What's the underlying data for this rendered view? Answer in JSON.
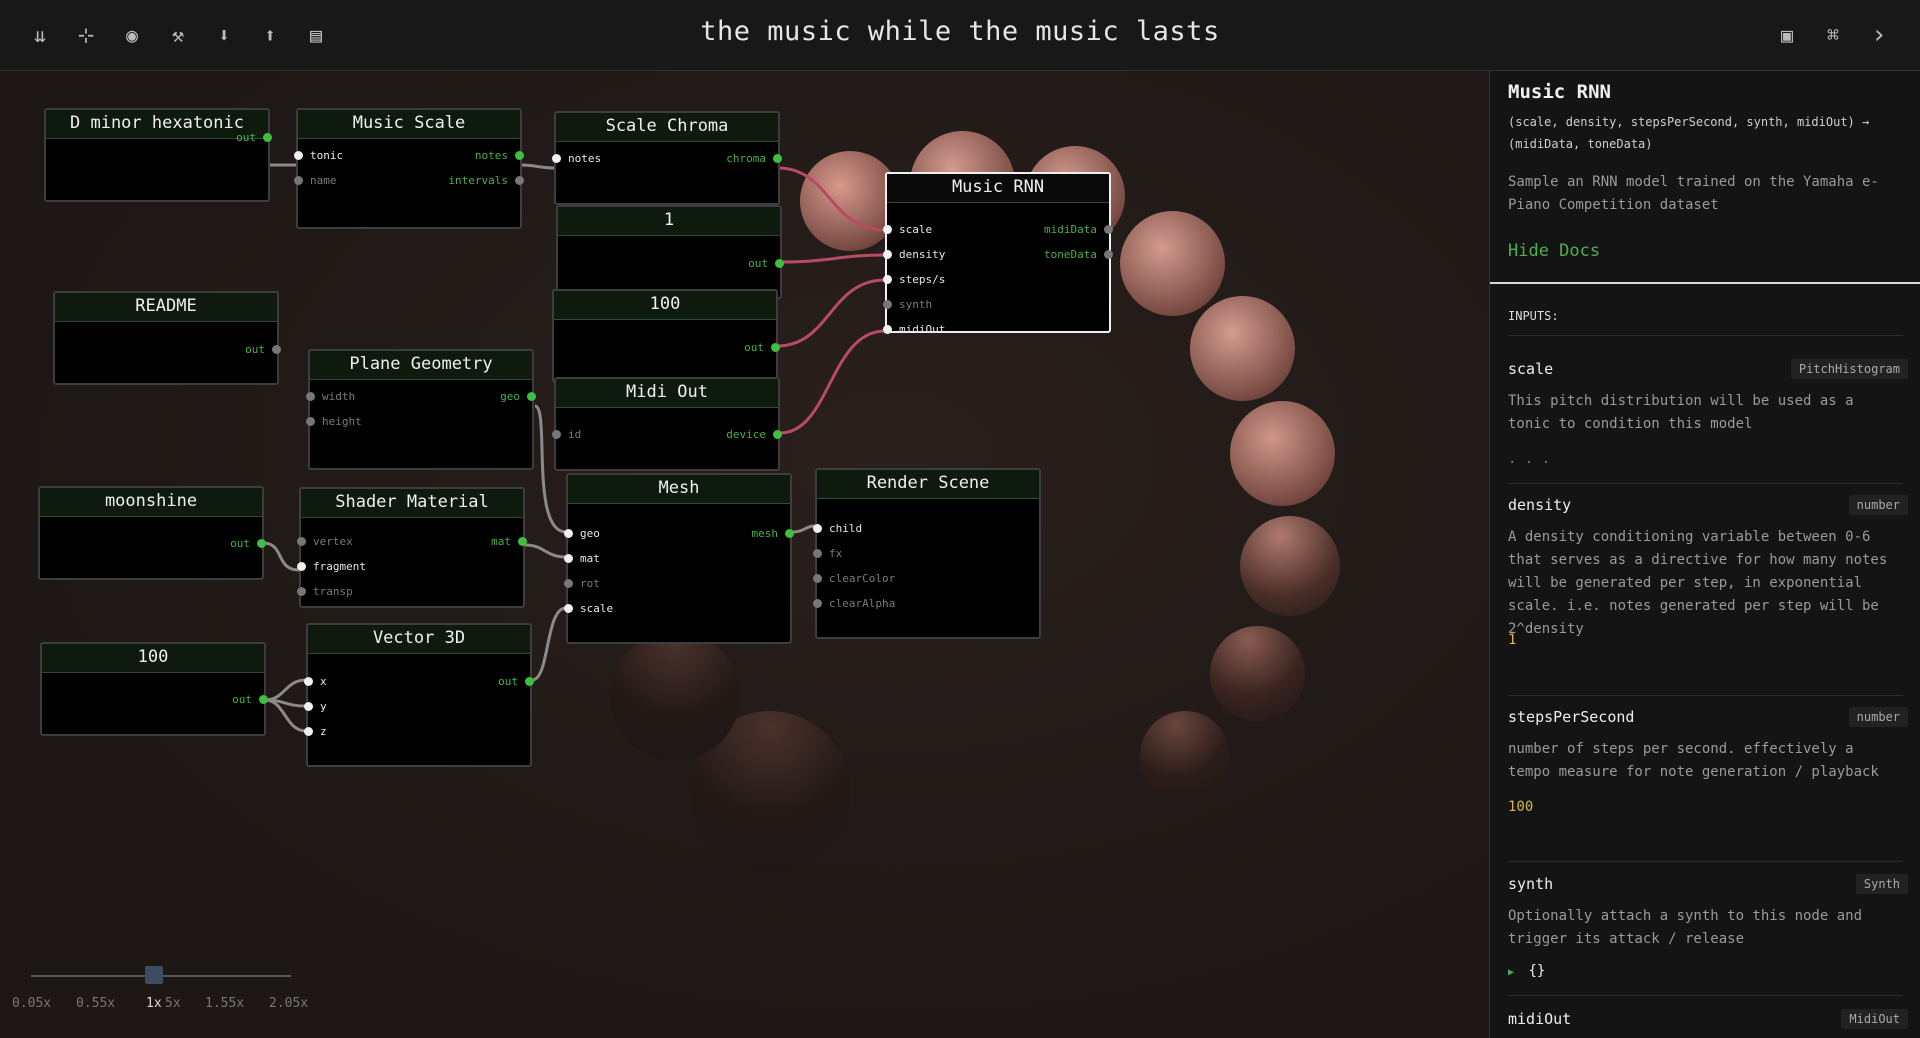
{
  "app": {
    "title": "the music while the music lasts"
  },
  "toolbar_left": [
    {
      "name": "open-graph-icon",
      "glyph": "⇊"
    },
    {
      "name": "add-node-icon",
      "glyph": "⊹"
    },
    {
      "name": "eye-icon",
      "glyph": "◉"
    },
    {
      "name": "build-icon",
      "glyph": "⚒"
    },
    {
      "name": "download-icon",
      "glyph": "⬇"
    },
    {
      "name": "upload-icon",
      "glyph": "⬆"
    },
    {
      "name": "layout-icon",
      "glyph": "▤"
    }
  ],
  "toolbar_right": [
    {
      "name": "panel-icon",
      "glyph": "▣"
    },
    {
      "name": "command-icon",
      "glyph": "⌘"
    },
    {
      "name": "chevron-right-icon",
      "glyph": "›"
    }
  ],
  "nodes": {
    "dminor": {
      "title": "D minor hexatonic",
      "out": "out"
    },
    "musicscale": {
      "title": "Music Scale",
      "in": [
        "tonic",
        "name"
      ],
      "out": [
        "notes",
        "intervals"
      ]
    },
    "scalechroma": {
      "title": "Scale Chroma",
      "in": [
        "notes"
      ],
      "out": [
        "chroma"
      ]
    },
    "one": {
      "title": "1",
      "out": "out"
    },
    "hundred_a": {
      "title": "100",
      "out": "out"
    },
    "readme": {
      "title": "README",
      "out": "out"
    },
    "plane": {
      "title": "Plane Geometry",
      "in": [
        "width",
        "height"
      ],
      "out": [
        "geo"
      ]
    },
    "midiout": {
      "title": "Midi Out",
      "in": [
        "id"
      ],
      "out": [
        "device"
      ]
    },
    "rnn": {
      "title": "Music RNN",
      "in": [
        "scale",
        "density",
        "steps/s",
        "synth",
        "midiOut"
      ],
      "out": [
        "midiData",
        "toneData"
      ]
    },
    "moonshine": {
      "title": "moonshine",
      "out": "out"
    },
    "shader": {
      "title": "Shader Material",
      "in": [
        "vertex",
        "fragment",
        "transp"
      ],
      "out": [
        "mat"
      ]
    },
    "mesh": {
      "title": "Mesh",
      "in": [
        "geo",
        "mat",
        "rot",
        "scale"
      ],
      "out": [
        "mesh"
      ]
    },
    "render": {
      "title": "Render Scene",
      "in": [
        "child",
        "fx",
        "clearColor",
        "clearAlpha"
      ]
    },
    "hundred_b": {
      "title": "100",
      "out": "out"
    },
    "vector": {
      "title": "Vector 3D",
      "in": [
        "x",
        "y",
        "z"
      ],
      "out": [
        "out"
      ]
    }
  },
  "zoom": {
    "labels": [
      "0.05x",
      "0.55x",
      "1x",
      "5x",
      "1.55x",
      "2.05x"
    ],
    "value": 1
  },
  "docs": {
    "title": "Music RNN",
    "signature": "(scale, density, stepsPerSecond, synth, midiOut) → (midiData, toneData)",
    "description": "Sample an RNN model trained on the Yamaha e-Piano Competition dataset",
    "hide_label": "Hide Docs",
    "inputs_label": "INPUTS:",
    "params": [
      {
        "name": "scale",
        "type": "PitchHistogram",
        "desc": "This pitch distribution will be used as a tonic to condition this model",
        "value": ". . ."
      },
      {
        "name": "density",
        "type": "number",
        "desc": "A density conditioning variable between 0-6 that serves as a directive for how many notes will be generated per step, in exponential scale. i.e. notes generated per step will be 2^density",
        "value": "1"
      },
      {
        "name": "stepsPerSecond",
        "type": "number",
        "desc": "number of steps per second. effectively a tempo measure for note generation / playback",
        "value": "100"
      },
      {
        "name": "synth",
        "type": "Synth",
        "desc": "Optionally attach a synth to this node and trigger its attack / release",
        "value": "{}"
      },
      {
        "name": "midiOut",
        "type": "MidiOut",
        "desc": "",
        "value": ""
      }
    ]
  },
  "colors": {
    "accent": "#4caf50",
    "edge_red": "#b84a63",
    "edge_grey": "#8a8a8a",
    "value_yellow": "#d4b84a"
  }
}
